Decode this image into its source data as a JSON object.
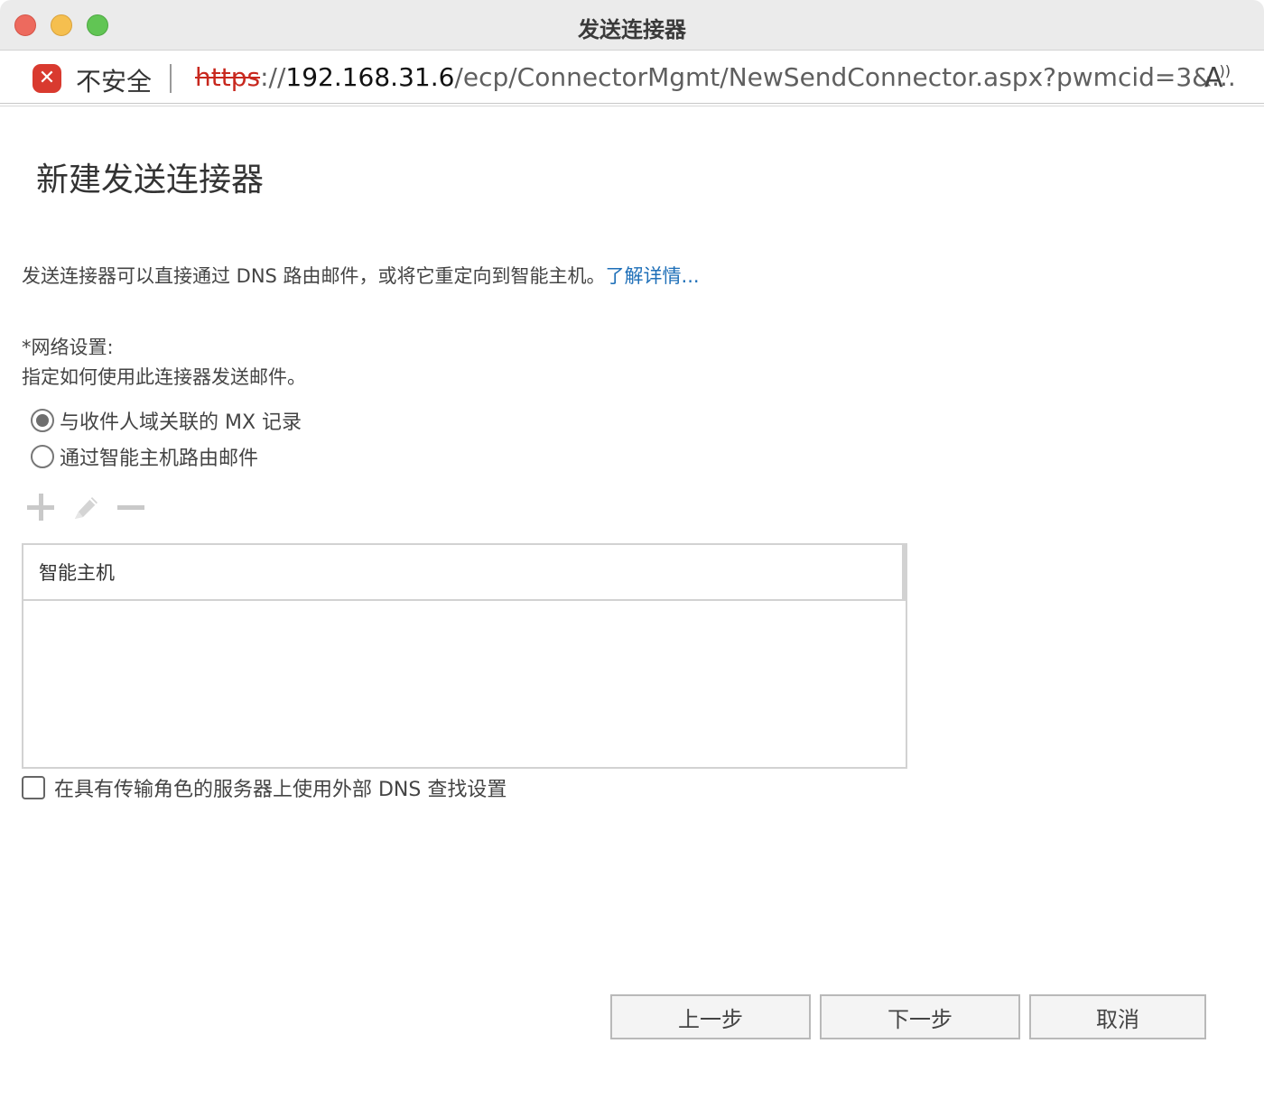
{
  "window": {
    "title": "发送连接器"
  },
  "address_bar": {
    "security_label": "不安全",
    "url_scheme": "https",
    "url_sep": "://",
    "url_host": "192.168.31.6",
    "url_path": "/ecp/ConnectorMgmt/NewSendConnector.aspx?pwmcid=3&...",
    "icons": {
      "security": "insecure-icon",
      "reader": "reader-aloud-icon"
    }
  },
  "page": {
    "title": "新建发送连接器",
    "intro_text": "发送连接器可以直接通过 DNS 路由邮件，或将它重定向到智能主机。",
    "learn_more": "了解详情...",
    "network_label": "*网络设置:",
    "network_desc": "指定如何使用此连接器发送邮件。",
    "radio_options": [
      {
        "label": "与收件人域关联的 MX 记录",
        "checked": true
      },
      {
        "label": "通过智能主机路由邮件",
        "checked": false
      }
    ],
    "toolbar_icons": [
      "add-icon",
      "edit-icon",
      "remove-icon"
    ],
    "grid": {
      "column_header": "智能主机",
      "rows": []
    },
    "external_dns_checkbox": {
      "label": "在具有传输角色的服务器上使用外部 DNS 查找设置",
      "checked": false
    }
  },
  "buttons": {
    "back": "上一步",
    "next": "下一步",
    "cancel": "取消"
  }
}
